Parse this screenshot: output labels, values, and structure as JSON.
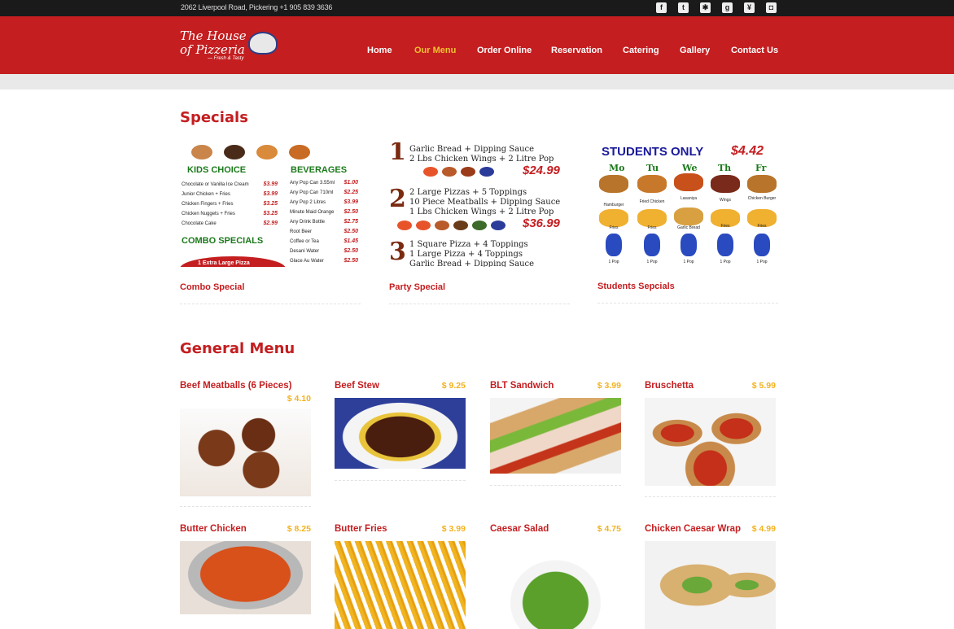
{
  "topbar": {
    "address": "2062 Liverpool Road, Pickering +1 905 839 3636",
    "social": [
      "facebook-icon",
      "twitter-icon",
      "yelp-icon",
      "google-plus-icon",
      "yen-icon",
      "instagram-icon"
    ]
  },
  "logo": {
    "line1": "The House",
    "line2": "of Pizzeria",
    "tagline": "— Fresh & Tasty"
  },
  "nav": [
    {
      "label": "Home",
      "active": false
    },
    {
      "label": "Our Menu",
      "active": true
    },
    {
      "label": "Order Online",
      "active": false
    },
    {
      "label": "Reservation",
      "active": false
    },
    {
      "label": "Catering",
      "active": false
    },
    {
      "label": "Gallery",
      "active": false
    },
    {
      "label": "Contact Us",
      "active": false
    }
  ],
  "specials": {
    "title": "Specials",
    "items": [
      {
        "caption": "Combo Special",
        "kids_choice": "KIDS CHOICE",
        "beverages": "BEVERAGES",
        "combo_specials": "COMBO SPECIALS",
        "banner": "1 Extra Large Pizza",
        "kids_items": [
          "Chocolate or Vanilla Ice Cream",
          "Junior Chicken + Fries",
          "Chicken Fingers + Fries",
          "Chicken Nuggets + Fries",
          "Chocolate Cake"
        ],
        "kids_prices": [
          "$3.99",
          "$3.99",
          "$3.25",
          "$3.25",
          "$2.99"
        ],
        "bev_items": [
          "Any Pop Can 3.55ml",
          "Any Pop Can 710ml",
          "Any Pop 2 Litres",
          "Minute Maid Orange",
          "Any Drink Bottle",
          "Root Beer",
          "Coffee or Tea",
          "Desani Water",
          "Glace Au Water"
        ],
        "bev_prices": [
          "$1.00",
          "$2.25",
          "$3.99",
          "$2.50",
          "$2.75",
          "$2.50",
          "$1.45",
          "$2.50",
          "$2.50"
        ]
      },
      {
        "caption": "Party Special",
        "deal1": [
          "Garlic Bread + Dipping Sauce",
          "2 Lbs Chicken Wings + 2 Litre Pop"
        ],
        "deal1_price": "$24.99",
        "deal2": [
          "2 Large Pizzas + 5 Toppings",
          "10 Piece Meatballs + Dipping Sauce",
          "1 Lbs Chicken Wings + 2 Litre Pop"
        ],
        "deal2_price": "$36.99",
        "deal3": [
          "1 Square Pizza + 4 Toppings",
          "1 Large Pizza + 4 Toppings",
          "Garlic Bread + Dipping Sauce"
        ]
      },
      {
        "caption": "Students Sepcials",
        "heading": "STUDENTS ONLY",
        "price": "$4.42",
        "days": [
          "Mo",
          "Tu",
          "We",
          "Th",
          "Fr"
        ],
        "mains": [
          "Hamburger",
          "Fried Chicken",
          "Lasaniya",
          "Wings",
          "Chicken Burger"
        ],
        "sides": [
          "Fries",
          "Fries",
          "Garlic Bread",
          "Fries",
          "Fries"
        ],
        "drink": "1 Pop"
      }
    ]
  },
  "general_menu": {
    "title": "General Menu",
    "items": [
      {
        "name": "Beef Meatballs (6 Pieces)",
        "price": "$ 4.10"
      },
      {
        "name": "Beef Stew",
        "price": "$ 9.25"
      },
      {
        "name": "BLT Sandwich",
        "price": "$ 3.99"
      },
      {
        "name": "Bruschetta",
        "price": "$ 5.99"
      },
      {
        "name": "Butter Chicken",
        "price": "$ 8.25"
      },
      {
        "name": "Butter Fries",
        "price": "$ 3.99"
      },
      {
        "name": "Caesar Salad",
        "price": "$ 4.75"
      },
      {
        "name": "Chicken Caesar Wrap",
        "price": "$ 4.99"
      }
    ]
  },
  "colors": {
    "brand_red": "#c41e20",
    "accent_yellow": "#f2b21e",
    "topbar": "#1a1a1a"
  }
}
